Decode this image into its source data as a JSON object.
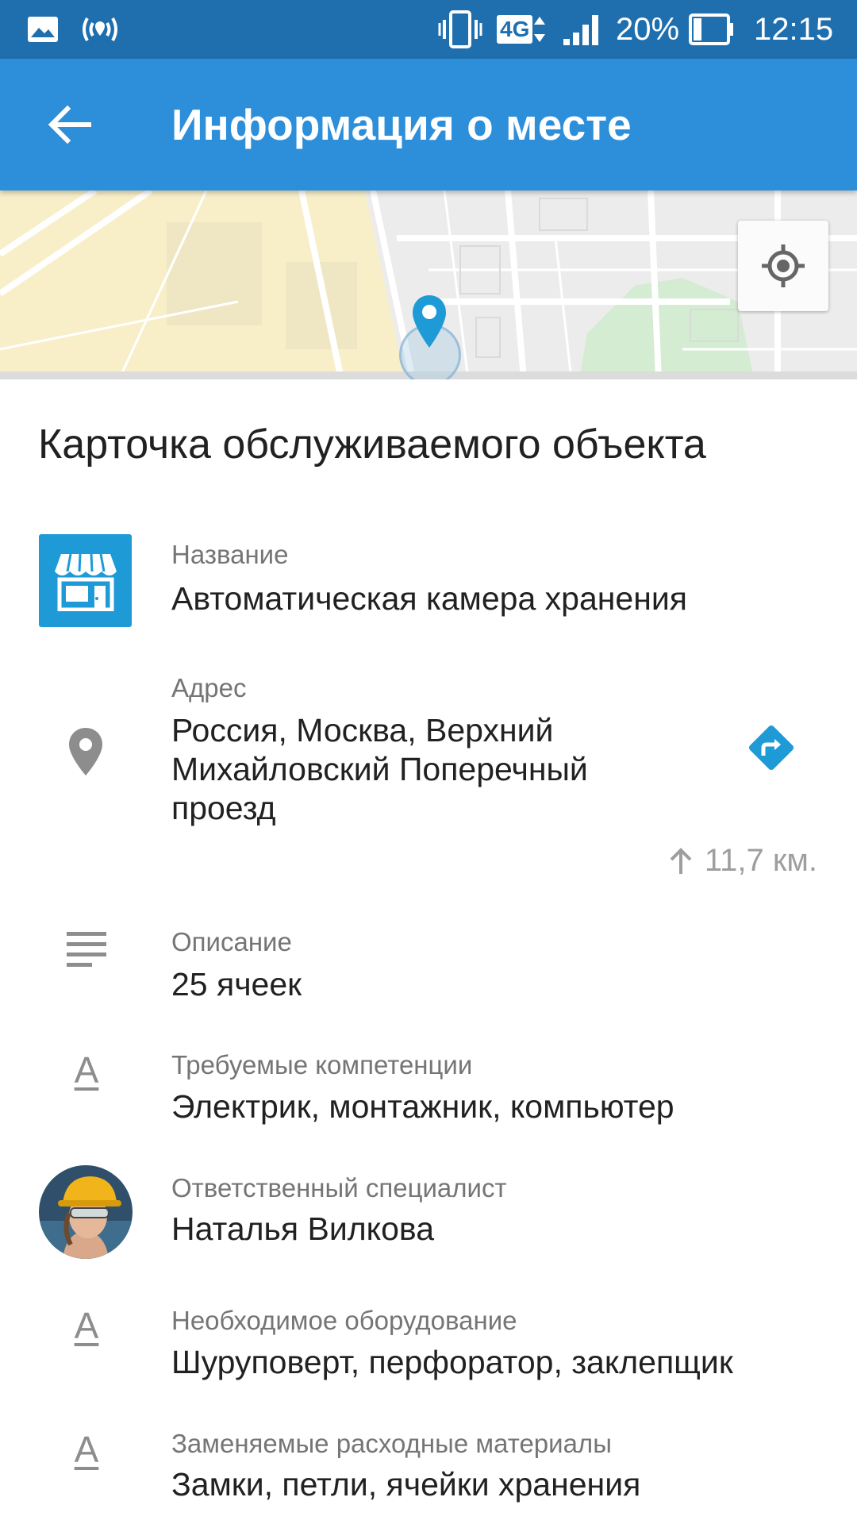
{
  "status_bar": {
    "network": "4G",
    "battery": "20%",
    "time": "12:15"
  },
  "app_bar": {
    "title": "Информация о месте",
    "back_icon": "arrow-back-icon"
  },
  "map": {
    "locate_icon": "my-location-icon",
    "pin_icon": "map-pin-icon",
    "colors": {
      "road": "#ffffff",
      "land": "#ececec",
      "yellow_area": "#f8efc9",
      "park": "#d4ecd1",
      "pin": "#1e9bd7"
    }
  },
  "card": {
    "title": "Карточка обслуживаемого объекта",
    "name": {
      "label": "Название",
      "value": "Автоматическая камера хранения",
      "icon": "store-icon"
    },
    "address": {
      "label": "Адрес",
      "lines": [
        "Россия, Москва, Верхний",
        "Михайловский Поперечный",
        "проезд"
      ],
      "icon": "location-pin-icon",
      "directions_icon": "directions-icon",
      "distance": "11,7 км.",
      "distance_icon": "arrow-up-icon"
    },
    "description": {
      "label": "Описание",
      "value": "25 ячеек",
      "icon": "notes-icon"
    },
    "competencies": {
      "label": "Требуемые компетенции",
      "value": "Электрик, монтажник, компьютер",
      "icon_glyph": "A",
      "icon": "text-format-icon"
    },
    "specialist": {
      "label": "Ответственный специалист",
      "value": "Наталья Вилкова",
      "icon": "avatar"
    },
    "equipment": {
      "label": "Необходимое оборудование",
      "value": "Шуруповерт, перфоратор, заклепщик",
      "icon_glyph": "A",
      "icon": "text-format-icon"
    },
    "consumables": {
      "label": "Заменяемые расходные материалы",
      "value": "Замки, петли, ячейки хранения",
      "icon_glyph": "A",
      "icon": "text-format-icon"
    }
  }
}
